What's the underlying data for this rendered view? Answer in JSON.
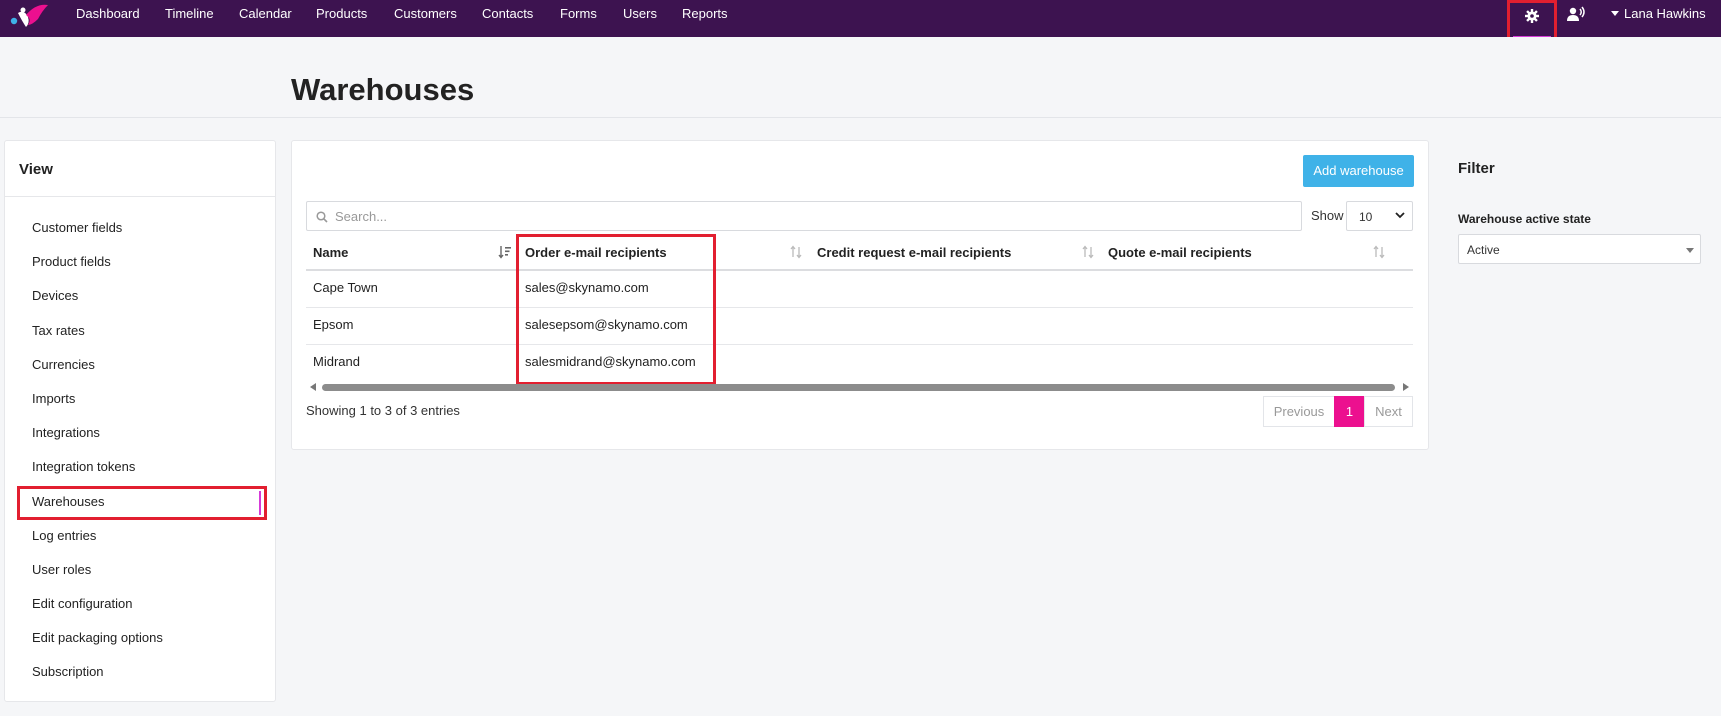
{
  "nav": {
    "items": [
      "Dashboard",
      "Timeline",
      "Calendar",
      "Products",
      "Customers",
      "Contacts",
      "Forms",
      "Users",
      "Reports"
    ],
    "user_name": "Lana Hawkins"
  },
  "page": {
    "title": "Warehouses"
  },
  "sidebar": {
    "title": "View",
    "items": [
      "Customer fields",
      "Product fields",
      "Devices",
      "Tax rates",
      "Currencies",
      "Imports",
      "Integrations",
      "Integration tokens",
      "Warehouses",
      "Log entries",
      "User roles",
      "Edit configuration",
      "Edit packaging options",
      "Subscription"
    ],
    "selected": "Warehouses"
  },
  "toolbar": {
    "add_label": "Add warehouse",
    "search_placeholder": "Search...",
    "show_label": "Show",
    "show_value": "10"
  },
  "table": {
    "headers": [
      "Name",
      "Order e-mail recipients",
      "Credit request e-mail recipients",
      "Quote e-mail recipients"
    ],
    "rows": [
      [
        "Cape Town",
        "sales@skynamo.com",
        "",
        ""
      ],
      [
        "Epsom",
        "salesepsom@skynamo.com",
        "",
        ""
      ],
      [
        "Midrand",
        "salesmidrand@skynamo.com",
        "",
        ""
      ]
    ]
  },
  "pagination": {
    "info": "Showing 1 to 3 of 3 entries",
    "previous": "Previous",
    "current": "1",
    "next": "Next"
  },
  "filter": {
    "title": "Filter",
    "label": "Warehouse active state",
    "value": "Active"
  },
  "colors": {
    "nav_bg": "#3d1350",
    "accent_blue": "#3fb2e8",
    "accent_pink": "#ec108f",
    "highlight_red": "#e21f30"
  }
}
